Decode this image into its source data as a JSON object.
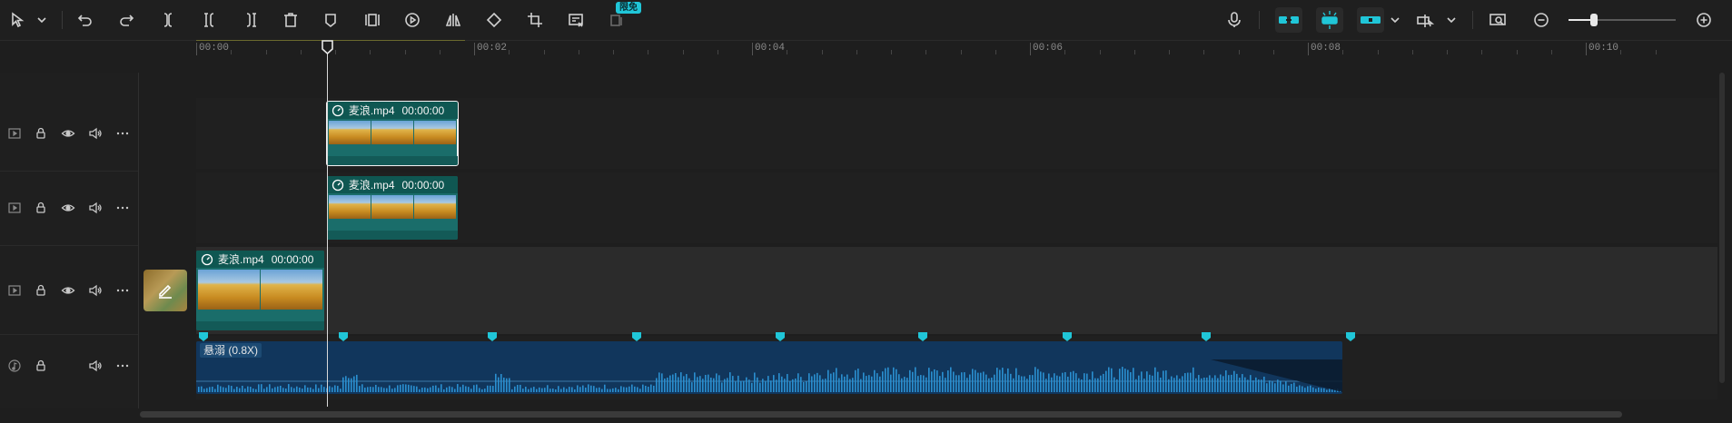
{
  "toolbar": {
    "left_tools": [
      {
        "name": "select-pointer-icon"
      },
      {
        "name": "chevron-down-icon"
      },
      {
        "name": "undo-icon"
      },
      {
        "name": "redo-icon"
      },
      {
        "name": "split-icon"
      },
      {
        "name": "split-left-icon"
      },
      {
        "name": "split-right-icon"
      },
      {
        "name": "delete-icon"
      },
      {
        "name": "marker-icon"
      },
      {
        "name": "freeze-frame-icon"
      },
      {
        "name": "reverse-play-icon"
      },
      {
        "name": "mirror-icon"
      },
      {
        "name": "rotate-icon"
      },
      {
        "name": "crop-icon"
      },
      {
        "name": "edit-cover-icon"
      },
      {
        "name": "smart-cutout-icon"
      }
    ],
    "free_badge": "限免",
    "right_tools": [
      {
        "name": "microphone-icon"
      },
      {
        "name": "main-track-magnet-icon"
      },
      {
        "name": "auto-snap-icon"
      },
      {
        "name": "linkage-icon"
      },
      {
        "name": "preview-axis-icon"
      },
      {
        "name": "fit-timeline-icon"
      },
      {
        "name": "zoom-out-icon"
      },
      {
        "name": "zoom-in-icon"
      }
    ],
    "zoom_level": 0.24
  },
  "ruler": {
    "labels": [
      "00:00",
      "00:02",
      "00:04",
      "00:06",
      "00:08",
      "00:10"
    ],
    "seconds_visible": 10.5
  },
  "playhead_time_seconds": 0.94,
  "tracks": [
    {
      "id": "video-3",
      "clips": [
        {
          "name": "麦浪.mp4",
          "time": "00:00:00",
          "start": 0.94,
          "duration": 0.94,
          "selected": true
        }
      ]
    },
    {
      "id": "video-2",
      "clips": [
        {
          "name": "麦浪.mp4",
          "time": "00:00:00",
          "start": 0.94,
          "duration": 0.94,
          "selected": false
        }
      ]
    },
    {
      "id": "video-1-main",
      "clips": [
        {
          "name": "麦浪.mp4",
          "time": "00:00:00",
          "start": 0.0,
          "duration": 0.92,
          "selected": false
        }
      ]
    },
    {
      "id": "audio-1",
      "clips": [
        {
          "name": "悬溺 (0.8X)",
          "start": 0.0,
          "duration": 8.25
        }
      ]
    }
  ],
  "beat_markers_seconds": [
    0.05,
    1.06,
    2.13,
    3.17,
    4.2,
    5.23,
    6.27,
    7.27,
    8.31
  ],
  "colors": {
    "accent": "#20c6d8",
    "video_clip": "#1a6d6a",
    "audio_clip": "#11365c",
    "waveform": "#2a8fd0"
  }
}
